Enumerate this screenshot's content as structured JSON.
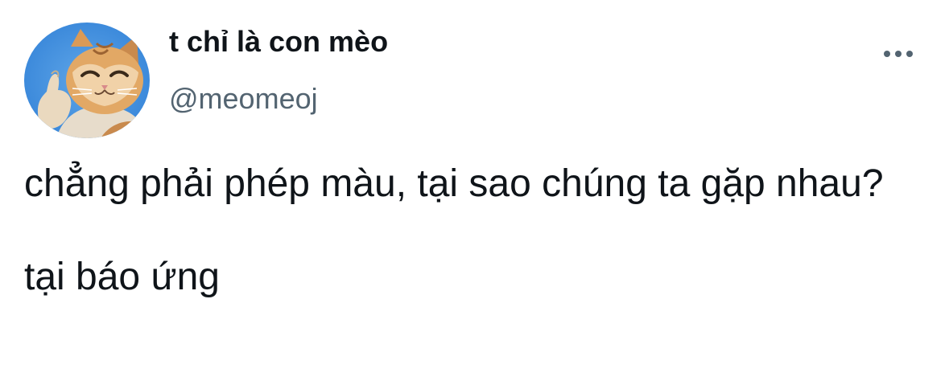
{
  "user": {
    "display_name": "t chỉ là con mèo",
    "handle": "@meomeoj",
    "avatar_icon": "cat-thumbs-up-avatar"
  },
  "menu": {
    "more_icon": "more-horizontal-icon"
  },
  "tweet": {
    "line1": "chẳng phải phép màu, tại sao chúng ta gặp nhau?",
    "line2": "tại báo ứng"
  },
  "colors": {
    "text": "#0f1419",
    "secondary": "#536471",
    "background": "#ffffff"
  }
}
